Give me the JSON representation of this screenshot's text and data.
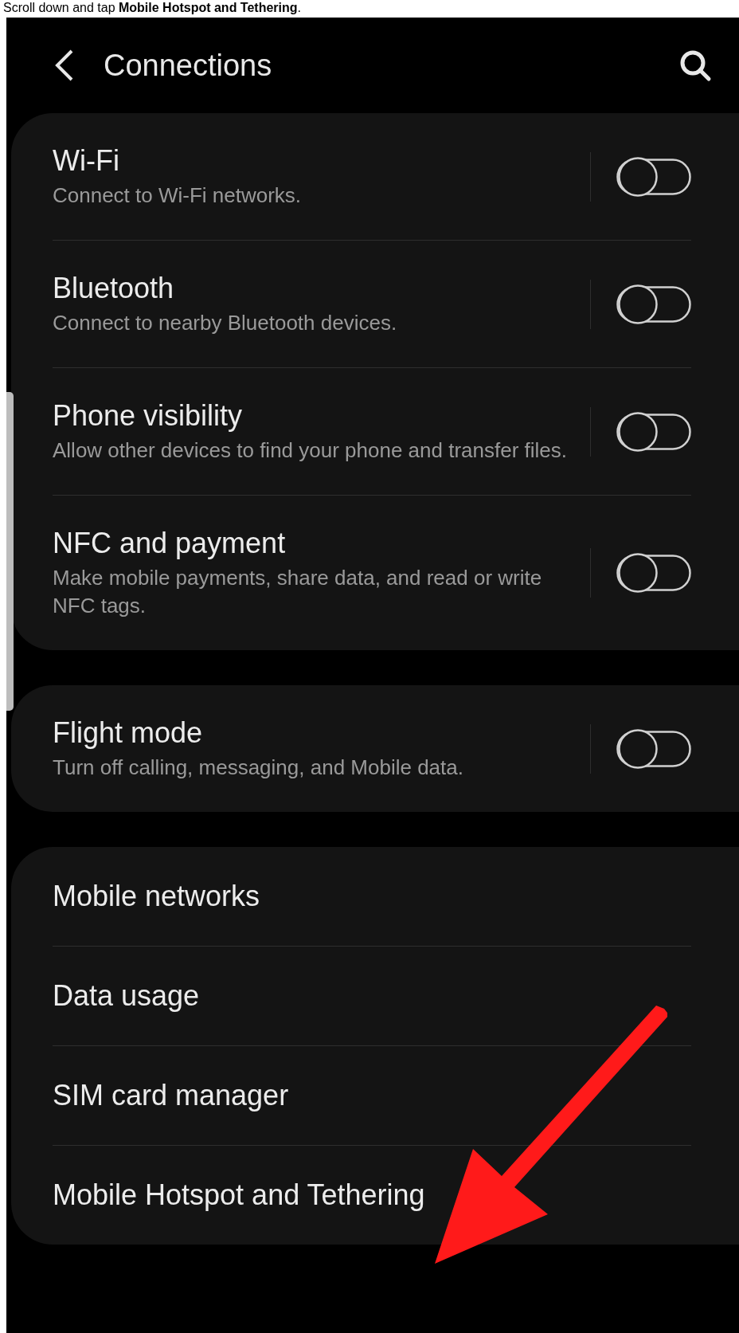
{
  "caption": "Scroll down and tap **Mobile Hotspot and Tethering**.",
  "header": {
    "title": "Connections"
  },
  "groups": [
    {
      "items": [
        {
          "kind": "toggle",
          "title": "Wi-Fi",
          "subtitle": "Connect to Wi-Fi networks.",
          "on": false
        },
        {
          "kind": "toggle",
          "title": "Bluetooth",
          "subtitle": "Connect to nearby Bluetooth devices.",
          "on": false
        },
        {
          "kind": "toggle",
          "title": "Phone visibility",
          "subtitle": "Allow other devices to find your phone and transfer files.",
          "on": false
        },
        {
          "kind": "toggle",
          "title": "NFC and payment",
          "subtitle": "Make mobile payments, share data, and read or write NFC tags.",
          "on": false
        }
      ]
    },
    {
      "items": [
        {
          "kind": "toggle",
          "title": "Flight mode",
          "subtitle": "Turn off calling, messaging, and Mobile data.",
          "on": false
        }
      ]
    },
    {
      "items": [
        {
          "kind": "link",
          "title": "Mobile networks"
        },
        {
          "kind": "link",
          "title": "Data usage"
        },
        {
          "kind": "link",
          "title": "SIM card manager"
        },
        {
          "kind": "link",
          "title": "Mobile Hotspot and Tethering"
        }
      ]
    }
  ]
}
